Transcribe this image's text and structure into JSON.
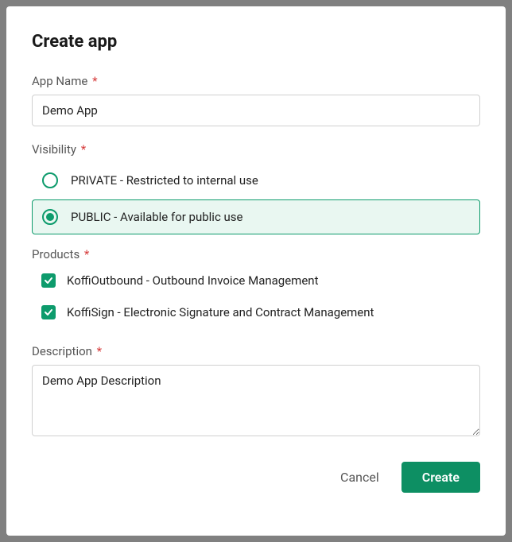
{
  "title": "Create app",
  "fields": {
    "appName": {
      "label": "App Name",
      "value": "Demo App"
    },
    "visibility": {
      "label": "Visibility",
      "options": [
        {
          "label": "PRIVATE - Restricted to internal use",
          "selected": false
        },
        {
          "label": "PUBLIC - Available for public use",
          "selected": true
        }
      ]
    },
    "products": {
      "label": "Products",
      "options": [
        {
          "label": "KoffiOutbound - Outbound Invoice Management",
          "checked": true
        },
        {
          "label": "KoffiSign - Electronic Signature and Contract Management",
          "checked": true
        }
      ]
    },
    "description": {
      "label": "Description",
      "value": "Demo App Description"
    }
  },
  "footer": {
    "cancel": "Cancel",
    "create": "Create"
  },
  "required_mark": "*"
}
